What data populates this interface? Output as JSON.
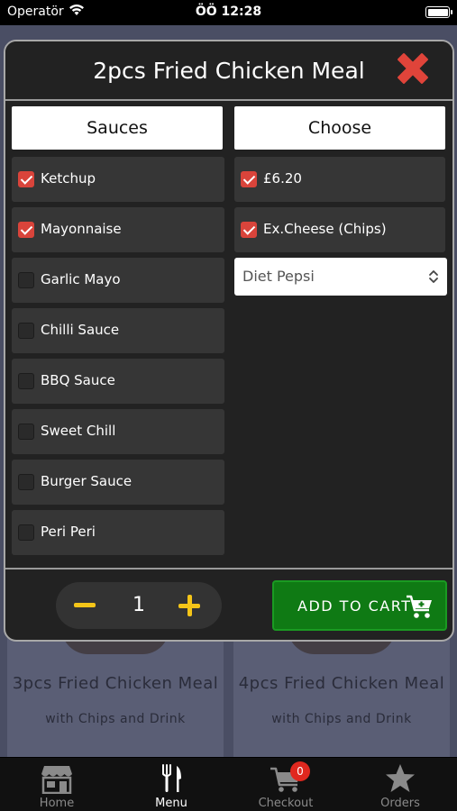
{
  "status_bar": {
    "carrier": "Operatör",
    "time": "ÖÖ 12:28"
  },
  "background_cards": [
    {
      "title": "3pcs Fried Chicken Meal",
      "subtitle": "with Chips and Drink"
    },
    {
      "title": "4pcs Fried Chicken Meal",
      "subtitle": "with Chips and Drink"
    }
  ],
  "modal": {
    "title": "2pcs Fried Chicken Meal",
    "sauces_header": "Sauces",
    "choose_header": "Choose",
    "sauces": [
      {
        "label": "Ketchup",
        "checked": true
      },
      {
        "label": "Mayonnaise",
        "checked": true
      },
      {
        "label": "Garlic Mayo",
        "checked": false
      },
      {
        "label": "Chilli Sauce",
        "checked": false
      },
      {
        "label": "BBQ Sauce",
        "checked": false
      },
      {
        "label": "Sweet Chill",
        "checked": false
      },
      {
        "label": "Burger Sauce",
        "checked": false
      },
      {
        "label": "Peri Peri",
        "checked": false
      }
    ],
    "choose": [
      {
        "label": "£6.20",
        "checked": true
      },
      {
        "label": "Ex.Cheese (Chips)",
        "checked": true
      }
    ],
    "drink_select": {
      "value": "Diet Pepsi"
    },
    "quantity": "1",
    "add_to_cart_label": "ADD TO CART"
  },
  "tabbar": {
    "tabs": [
      {
        "label": "Home",
        "icon": "store-icon",
        "active": false
      },
      {
        "label": "Menu",
        "icon": "fork-knife-icon",
        "active": true
      },
      {
        "label": "Checkout",
        "icon": "cart-icon",
        "active": false,
        "badge": "0"
      },
      {
        "label": "Orders",
        "icon": "star-icon",
        "active": false
      }
    ]
  },
  "colors": {
    "accent_red": "#d9443b",
    "add_green": "#0f7a14",
    "stepper_yellow": "#f5c518",
    "badge_red": "#e0281f"
  }
}
